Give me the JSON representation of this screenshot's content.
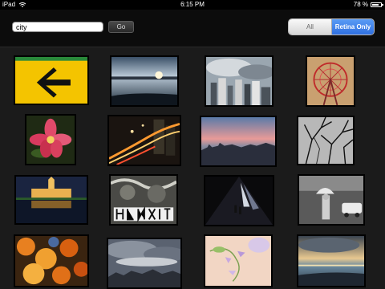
{
  "status_bar": {
    "carrier": "iPad",
    "time": "6:15 PM",
    "battery": "78 %",
    "battery_level": 0.78
  },
  "search": {
    "value": "city",
    "go_label": "Go"
  },
  "filter": {
    "all_label": "All",
    "retina_label": "Retina Only",
    "selected": "Retina Only"
  },
  "photos": [
    "yellow-arrow-sign",
    "harbor-sunset",
    "city-skyline-clouds",
    "ferris-wheel",
    "pink-flower",
    "city-night-traffic",
    "sunset-city-view",
    "bare-tree-branches",
    "palace-night-reflection",
    "graffiti-wall",
    "tunnel-figures",
    "street-umbrella-bw",
    "autumn-leaves",
    "cloudy-cityscape",
    "pastel-flowers",
    "beach-sunset"
  ]
}
